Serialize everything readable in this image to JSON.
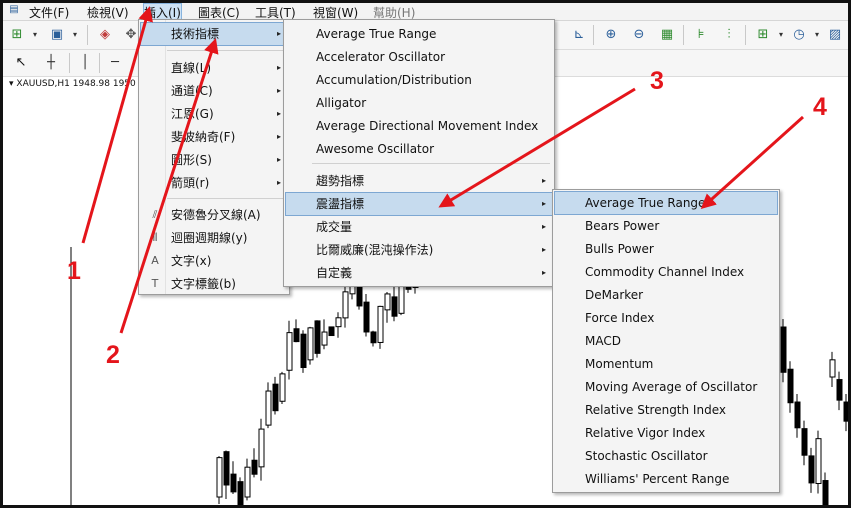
{
  "menubar": {
    "items": [
      "文件(F)",
      "檢視(V)",
      "插入(I)",
      "圖表(C)",
      "工具(T)",
      "視窗(W)",
      "幫助(H)"
    ],
    "active_index": 2
  },
  "chart": {
    "symbol_label": "XAUUSD,H1  1948.98 1950"
  },
  "insert_menu": {
    "items": [
      {
        "label": "技術指標",
        "arrow": "▸"
      },
      {
        "label": "直線(L)",
        "arrow": "▸"
      },
      {
        "label": "通道(C)",
        "arrow": "▸"
      },
      {
        "label": "江恩(G)",
        "arrow": "▸"
      },
      {
        "label": "斐波納奇(F)",
        "arrow": "▸"
      },
      {
        "label": "圖形(S)",
        "arrow": "▸"
      },
      {
        "label": "箭頭(r)",
        "arrow": "▸"
      },
      {
        "label": "安德魯分叉線(A)",
        "icon": "⫽"
      },
      {
        "label": "迴圈週期線(y)",
        "icon": "⦀"
      },
      {
        "label": "文字(x)",
        "icon": "A"
      },
      {
        "label": "文字標籤(b)",
        "icon": "T"
      }
    ]
  },
  "indicators_menu": {
    "items": [
      {
        "label": "Average True Range"
      },
      {
        "label": "Accelerator Oscillator"
      },
      {
        "label": "Accumulation/Distribution"
      },
      {
        "label": "Alligator"
      },
      {
        "label": "Average Directional Movement Index"
      },
      {
        "label": "Awesome Oscillator"
      },
      {
        "label": "趨勢指標",
        "arrow": "▸"
      },
      {
        "label": "震盪指標",
        "arrow": "▸"
      },
      {
        "label": "成交量",
        "arrow": "▸"
      },
      {
        "label": "比爾威廉(混沌操作法)",
        "arrow": "▸"
      },
      {
        "label": "自定義",
        "arrow": "▸"
      }
    ]
  },
  "oscillators_menu": {
    "items": [
      "Average True Range",
      "Bears Power",
      "Bulls Power",
      "Commodity Channel Index",
      "DeMarker",
      "Force Index",
      "MACD",
      "Momentum",
      "Moving Average of Oscillator",
      "Relative Strength Index",
      "Relative Vigor Index",
      "Stochastic Oscillator",
      "Williams' Percent Range"
    ]
  },
  "annotations": {
    "labels": [
      "1",
      "2",
      "3",
      "4"
    ],
    "color": "#e4151b"
  },
  "colors": {
    "highlight": "#c6dbee",
    "menu_bg": "#f4f4f4",
    "candle": "#000000"
  }
}
